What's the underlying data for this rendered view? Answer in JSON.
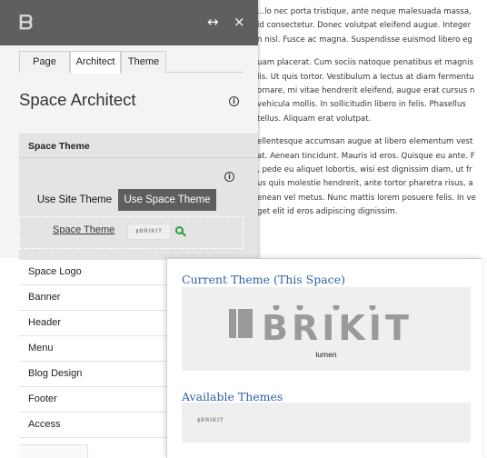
{
  "background_text": {
    "paragraphs": [
      [
        "...lo nec porta tristique, ante neque malesuada massa,",
        "id consectetur. Donec volutpat eleifend augue. Integer",
        "n nisl. Fusce ac magna. Suspendisse euismod libero eg"
      ],
      [
        "uam placerat. Cum sociis natoque penatibus et magnis",
        "lis. Ut quis tortor. Vestibulum a lectus at diam fermentu",
        "ornare, mi vitae hendrerit eleifend, augue erat cursus n",
        "vehicula mollis. In sollicitudin libero in felis. Phasellus",
        "tellus. Aliquam erat volutpat."
      ],
      [
        "ellentesque accumsan augue at libero elementum vest",
        "at. Aenean tincidunt. Mauris id eros. Quisque eu ante. F",
        ", pede eu aliquet lobortis, wisi est dignissim diam, ut fr",
        "us quis molestie hendrerit, ante tortor pharetra risus, a",
        "enean vel metus. Nunc mattis lorem posuere felis. In ve",
        "get elit id eros adipiscing dignissim."
      ]
    ]
  },
  "panel": {
    "logo_icon": "brikit-b-icon",
    "expand_icon_glyph": "↔",
    "close_icon_glyph": "×",
    "tabs": [
      {
        "label": "Page"
      },
      {
        "label": "Architect"
      },
      {
        "label": "Theme"
      }
    ],
    "title": "Space Architect",
    "info_glyph": "i",
    "section": {
      "title": "Space Theme",
      "use_site_theme": "Use Site Theme",
      "use_space_theme": "Use Space Theme",
      "theme_label": "Space Theme",
      "mini_logo_text": "▮BRIKIT"
    },
    "menu": [
      {
        "label": "Space Logo"
      },
      {
        "label": "Banner"
      },
      {
        "label": "Header"
      },
      {
        "label": "Menu"
      },
      {
        "label": "Blog Design"
      },
      {
        "label": "Footer"
      },
      {
        "label": "Access"
      }
    ]
  },
  "popup": {
    "current_title": "Current Theme (This Space)",
    "current_logo_text": "BRIKIT",
    "current_theme_name": "lumen",
    "available_title": "Available Themes",
    "available_logo_text": "▮BRIKIT"
  },
  "colors": {
    "header_bg": "#5f5f5f",
    "active_button_bg": "#5e5e5e",
    "link_blue": "#2f62a8",
    "search_green": "#2e9e3f"
  }
}
